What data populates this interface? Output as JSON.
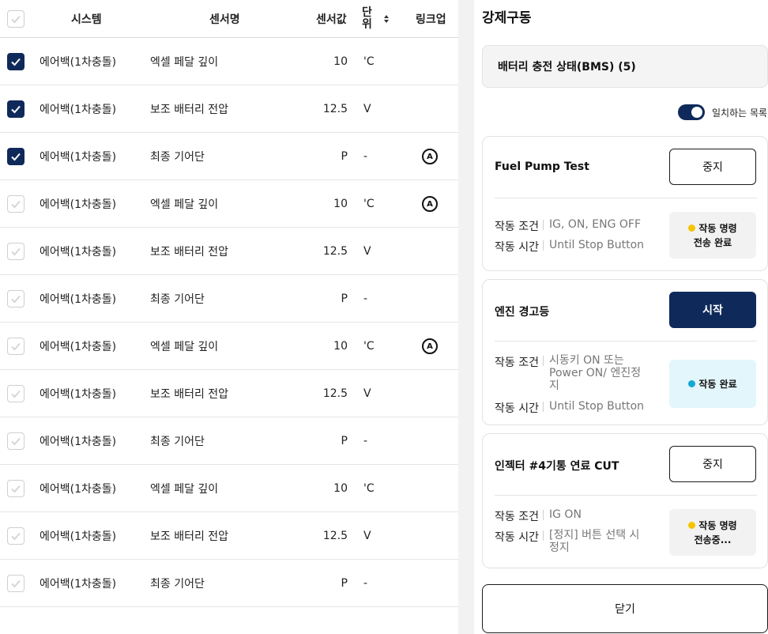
{
  "table": {
    "headers": {
      "system": "시스템",
      "sensor_name": "센서명",
      "sensor_value": "센서값",
      "unit": "단위",
      "linkup": "링크업"
    },
    "rows": [
      {
        "checked": true,
        "system": "에어백(1차충돌)",
        "sensor": "엑셀 페달 깊이",
        "value": "10",
        "unit": "'C",
        "link": ""
      },
      {
        "checked": true,
        "system": "에어백(1차충돌)",
        "sensor": "보조 배터리 전압",
        "value": "12.5",
        "unit": "V",
        "link": ""
      },
      {
        "checked": true,
        "system": "에어백(1차충돌)",
        "sensor": "최종 기어단",
        "value": "P",
        "unit": "-",
        "link": "A"
      },
      {
        "checked": false,
        "system": "에어백(1차충돌)",
        "sensor": "엑셀 페달 깊이",
        "value": "10",
        "unit": "'C",
        "link": "A"
      },
      {
        "checked": false,
        "system": "에어백(1차충돌)",
        "sensor": "보조 배터리 전압",
        "value": "12.5",
        "unit": "V",
        "link": ""
      },
      {
        "checked": false,
        "system": "에어백(1차충돌)",
        "sensor": "최종 기어단",
        "value": "P",
        "unit": "-",
        "link": ""
      },
      {
        "checked": false,
        "system": "에어백(1차충돌)",
        "sensor": "엑셀 페달 깊이",
        "value": "10",
        "unit": "'C",
        "link": "A"
      },
      {
        "checked": false,
        "system": "에어백(1차충돌)",
        "sensor": "보조 배터리 전압",
        "value": "12.5",
        "unit": "V",
        "link": ""
      },
      {
        "checked": false,
        "system": "에어백(1차충돌)",
        "sensor": "최종 기어단",
        "value": "P",
        "unit": "-",
        "link": ""
      },
      {
        "checked": false,
        "system": "에어백(1차충돌)",
        "sensor": "엑셀 페달 깊이",
        "value": "10",
        "unit": "'C",
        "link": ""
      },
      {
        "checked": false,
        "system": "에어백(1차충돌)",
        "sensor": "보조 배터리 전압",
        "value": "12.5",
        "unit": "V",
        "link": ""
      },
      {
        "checked": false,
        "system": "에어백(1차충돌)",
        "sensor": "최종 기어단",
        "value": "P",
        "unit": "-",
        "link": ""
      }
    ]
  },
  "panel": {
    "title": "강제구동",
    "bms_label": "배터리 충전 상태(BMS) (5)",
    "toggle_label": "일치하는 목록",
    "toggle_on": true,
    "cards": [
      {
        "title": "Fuel Pump Test",
        "button": "중지",
        "button_style": "outline",
        "cond_label": "작동 조건",
        "cond_value": "IG, ON, ENG OFF",
        "time_label": "작동 시간",
        "time_value": "Until Stop Button",
        "status_line1": "작동 명령",
        "status_line2": "전송 완료",
        "status_dot_color": "#f5c400"
      },
      {
        "title": "엔진 경고등",
        "button": "시작",
        "button_style": "solid",
        "cond_label": "작동 조건",
        "cond_value": "시동키 ON 또는 Power ON/ 엔진정지",
        "time_label": "작동 시간",
        "time_value": "Until Stop Button",
        "status_line1": "작동 완료",
        "status_line2": "",
        "status_dot_color": "#16a7d4"
      },
      {
        "title": "인젝터 #4기통 연료 CUT",
        "button": "중지",
        "button_style": "outline",
        "cond_label": "작동 조건",
        "cond_value": "IG ON",
        "time_label": "작동 시간",
        "time_value": "[정지] 버튼 선택 시 정지",
        "status_line1": "작동 명령",
        "status_line2": "전송중...",
        "status_dot_color": "#f5c400"
      }
    ],
    "close_button": "닫기"
  },
  "colors": {
    "primary": "#0f2a5a",
    "pending_dot": "#f5c400",
    "done_dot": "#16a7d4"
  }
}
